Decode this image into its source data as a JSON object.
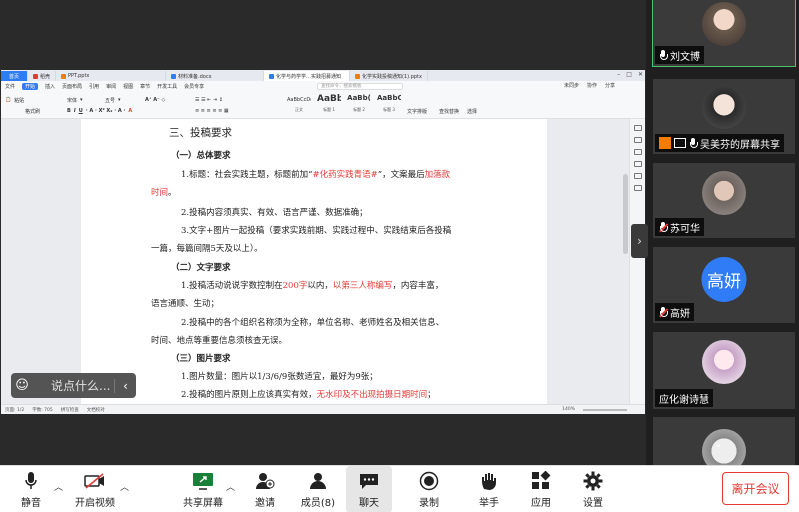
{
  "wps": {
    "tabs": [
      "首页",
      "稻壳",
      "PPT.pptx",
      "材料准备.docx",
      "化学与药学学…实践招募通知",
      "化学实践投稿通知(1).pptx"
    ],
    "menu": [
      "文件",
      "开始",
      "插入",
      "页面布局",
      "引用",
      "审阅",
      "视图",
      "章节",
      "开发工具",
      "会员专享"
    ],
    "search_placeholder": "查找命令、搜索模板",
    "right_tools": [
      "未同步",
      "协作",
      "分享"
    ],
    "tool_labels": {
      "paste": "粘贴",
      "font": "宋体",
      "size": "五号",
      "format_painter": "格式刷",
      "text_tool": "文字排版",
      "find_replace": "查找替换",
      "select": "选择"
    },
    "styles": [
      {
        "preview": "AaBbCcDd",
        "label": "正文"
      },
      {
        "preview": "AaBb",
        "label": "标题 1"
      },
      {
        "preview": "AaBb(",
        "label": "标题 2"
      },
      {
        "preview": "AaBbC(",
        "label": "标题 3"
      }
    ],
    "status": {
      "page": "页面: 1/2",
      "words": "字数: 705",
      "spell": "拼写检查",
      "proof": "文档校对",
      "zoom": "140%"
    }
  },
  "doc": {
    "heading": "三、投稿要求",
    "s1": "（一）总体要求",
    "p1a": "1.标题：社会实践主题，标题前加“",
    "p1tag": "#化药实践青语#",
    "p1b": "”，文案最后",
    "p1c": "加落款",
    "p1d": "时间",
    "p1e": "。",
    "p2": "2.投稿内容须真实、有效、语言严谨、数据准确；",
    "p3a": "3.文字+图片一起投稿（要求实践前期、实践过程中、实践结束后各投稿",
    "p3b": "一篇，每篇间隔5天及以上）。",
    "s2": "（二）文字要求",
    "p4a": "1.投稿活动说说字数控制在",
    "p4b": "200字",
    "p4c": "以内，",
    "p4d": "以第三人称编写",
    "p4e": "，内容丰富，",
    "p4f": "语言通顺、生动；",
    "p5a": "2.投稿中的各个组织名称须为全称，单位名称、老师姓名及相关信息、",
    "p5b": "时间、地点等重要信息须核查无误。",
    "s3": "（三）图片要求",
    "p6": "1.图片数量：图片以1/3/6/9张数适宜，最好为9张；",
    "p7a": "2.投稿的图片原则上应该真实有效，",
    "p7b": "无水印及不出现拍摄日期时间",
    "p7c": "；"
  },
  "chat_input": {
    "placeholder": "说点什么..."
  },
  "participants": [
    {
      "name": "刘文博",
      "mic": "on"
    },
    {
      "name": "吴美芬的屏幕共享",
      "mic": "on"
    },
    {
      "name": "苏可华",
      "mic": "off"
    },
    {
      "name": "高妍",
      "mic": "off",
      "initials": "高妍"
    },
    {
      "name": "应化谢诗慧",
      "mic": "none"
    },
    {
      "name": "",
      "mic": "none"
    }
  ],
  "toolbar": {
    "mute": "静音",
    "video": "开启视频",
    "share": "共享屏幕",
    "invite": "邀请",
    "members": "成员(8)",
    "chat": "聊天",
    "record": "录制",
    "raise_hand": "举手",
    "apps": "应用",
    "settings": "设置",
    "leave": "离开会议"
  },
  "colors": {
    "accent": "#2f7cf6",
    "danger": "#e53935",
    "active_speaker": "#52c16b"
  }
}
